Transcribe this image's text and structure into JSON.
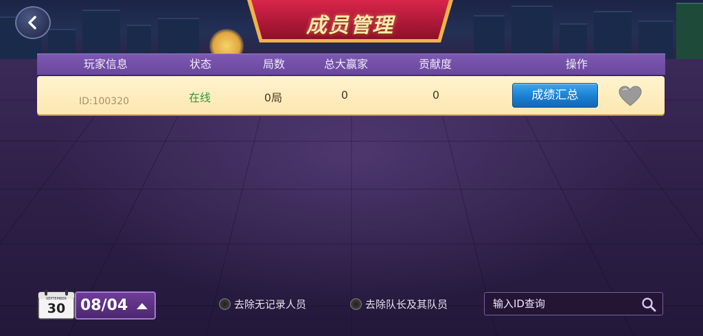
{
  "header": {
    "title": "成员管理",
    "back_icon": "chevron-left-icon"
  },
  "table": {
    "columns": [
      "玩家信息",
      "状态",
      "局数",
      "总大赢家",
      "贡献度",
      "操作"
    ],
    "rows": [
      {
        "player_id": "ID:100320",
        "status": "在线",
        "games": "0局",
        "big_winner": "0",
        "contribution": "0",
        "action_label": "成绩汇总",
        "favorite_icon": "heart-icon"
      }
    ]
  },
  "footer": {
    "calendar": {
      "month": "SEPTEMBER",
      "day": "30"
    },
    "date_value": "08/04",
    "filter_no_record": "去除无记录人员",
    "filter_captain": "去除队长及其队员",
    "search_placeholder": "输入ID查询",
    "search_icon": "search-icon"
  },
  "colors": {
    "header_bar": "#6a479c",
    "row_bg": "#fde7b0",
    "status_online": "#2f9a3e",
    "button_blue": "#1a7fd2",
    "id_text": "#a8916a"
  }
}
